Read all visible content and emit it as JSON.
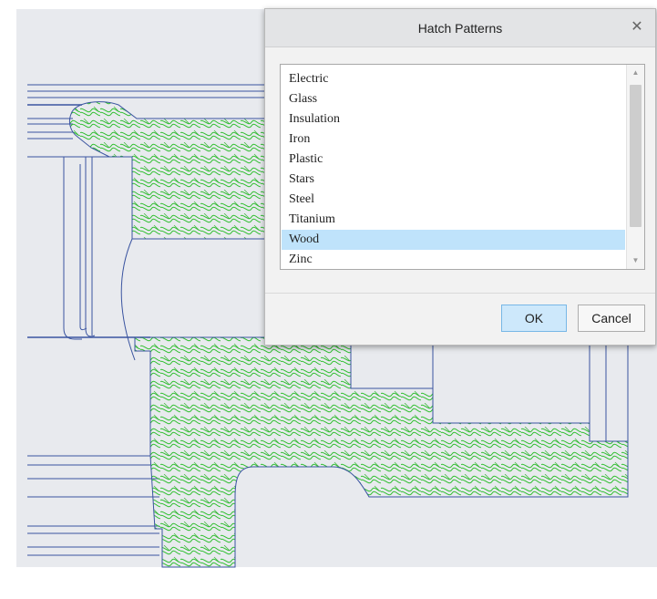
{
  "colors": {
    "background": "#e8eaee",
    "outline": "#3a54a0",
    "hatch": "#2fbf2f",
    "selection": "#bfe3fb",
    "ok_button": "#cde8fb"
  },
  "dialog": {
    "title": "Hatch Patterns",
    "close_icon": "close-icon",
    "list": {
      "items": [
        "Electric",
        "Glass",
        "Insulation",
        "Iron",
        "Plastic",
        "Stars",
        "Steel",
        "Titanium",
        "Wood",
        "Zinc"
      ],
      "selected": "Wood"
    },
    "buttons": {
      "ok": "OK",
      "cancel": "Cancel"
    }
  }
}
